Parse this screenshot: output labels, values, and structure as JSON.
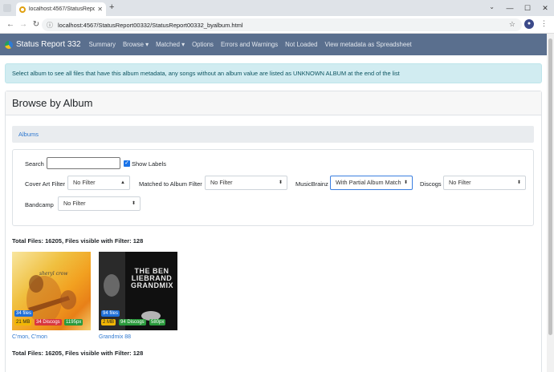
{
  "browser": {
    "tab_title": "localhost:4567/StatusReport00",
    "url": "localhost:4567/StatusReport00332/StatusReport00332_byalbum.html"
  },
  "nav": {
    "brand": "Status Report 332",
    "links": [
      "Summary",
      "Browse ▾",
      "Matched ▾",
      "Options",
      "Errors and Warnings",
      "Not Loaded",
      "View metadata as Spreadsheet"
    ]
  },
  "alert": "Select album to see all files that have this album metadata, any songs without an album value are listed as UNKNOWN ALBUM at the end of the list",
  "page_title": "Browse by Album",
  "tab_albums": "Albums",
  "filters": {
    "search_label": "Search",
    "search_value": "",
    "show_labels": "Show Labels",
    "cover_art_label": "Cover Art Filter",
    "cover_art_value": "No Filter",
    "matched_label": "Matched to Album Filter",
    "matched_value": "No Filter",
    "musicbrainz_label": "MusicBrainz",
    "musicbrainz_value": "With Partial Album Match",
    "discogs_label": "Discogs",
    "discogs_value": "No Filter",
    "bandcamp_label": "Bandcamp",
    "bandcamp_value": "No Filter"
  },
  "totals": "Total Files: 16205, Files visible with Filter: 128",
  "albums": [
    {
      "title": "C'mon, C'mon",
      "cover_text": "sheryl crow",
      "files": "34 files",
      "size": "21 MB",
      "discogs": "34 Discogs",
      "resolution": "1195px"
    },
    {
      "title": "Grandmix 88",
      "cover_text": "THE BEN LIEBRAND GRANDMIX",
      "files": "94 files",
      "size": "2 MB",
      "discogs": "94 Discogs",
      "resolution": "580px"
    }
  ]
}
